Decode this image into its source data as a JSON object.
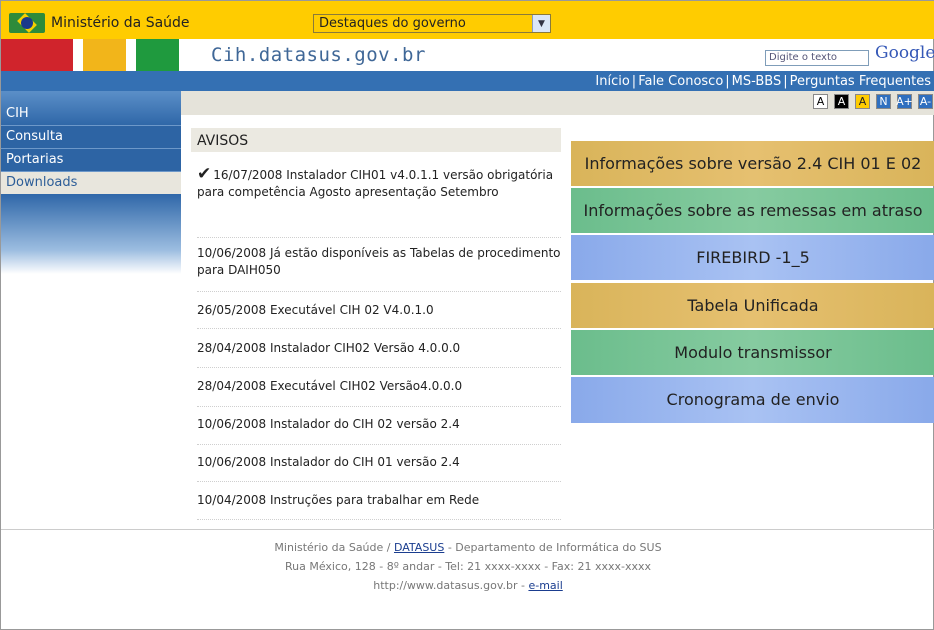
{
  "govbar": {
    "brand": "Ministério da Saúde",
    "dropdown": "Destaques do governo"
  },
  "header": {
    "site_name": "Cih.datasus.gov.br",
    "search_placeholder": "Digite o texto",
    "search_engine": "Google"
  },
  "topnav": {
    "links": [
      "Início",
      "Fale Conosco",
      "MS-BBS",
      "Perguntas Frequentes"
    ]
  },
  "font_controls": [
    "A",
    "A",
    "A",
    "N",
    "A+",
    "A-"
  ],
  "sidebar": {
    "title": "CIH",
    "items": [
      "Consulta",
      "Portarias",
      "Downloads"
    ]
  },
  "avisos": {
    "title": "AVISOS",
    "items": [
      "16/07/2008 Instalador CIH01 v4.0.1.1 versão obrigatória para competência Agosto apresentação Setembro",
      "10/06/2008 Já estão disponíveis as Tabelas de procedimento para DAIH050",
      "26/05/2008 Executável CIH 02 V4.0.1.0",
      "28/04/2008 Instalador CIH02 Versão 4.0.0.0",
      "28/04/2008 Executável CIH02 Versão4.0.0.0",
      "10/06/2008 Instalador do CIH 02 versão 2.4",
      "10/06/2008 Instalador do CIH 01 versão 2.4",
      "10/04/2008 Instruções para trabalhar em Rede"
    ]
  },
  "info_boxes": [
    "Informações sobre versão 2.4 CIH 01 E 02",
    "Informações sobre as remessas em atraso",
    "FIREBIRD -1_5",
    "Tabela Unificada",
    "Modulo transmissor",
    "Cronograma de envio"
  ],
  "footer": {
    "line1_prefix": "Ministério da Saúde / ",
    "line1_link": "DATASUS",
    "line1_suffix": " - Departamento de Informática do SUS",
    "line2": "Rua México, 128 - 8º andar - Tel: 21 xxxx-xxxx - Fax: 21 xxxx-xxxx",
    "line3_prefix": "http://www.datasus.gov.br - ",
    "line3_link": "e-mail"
  }
}
